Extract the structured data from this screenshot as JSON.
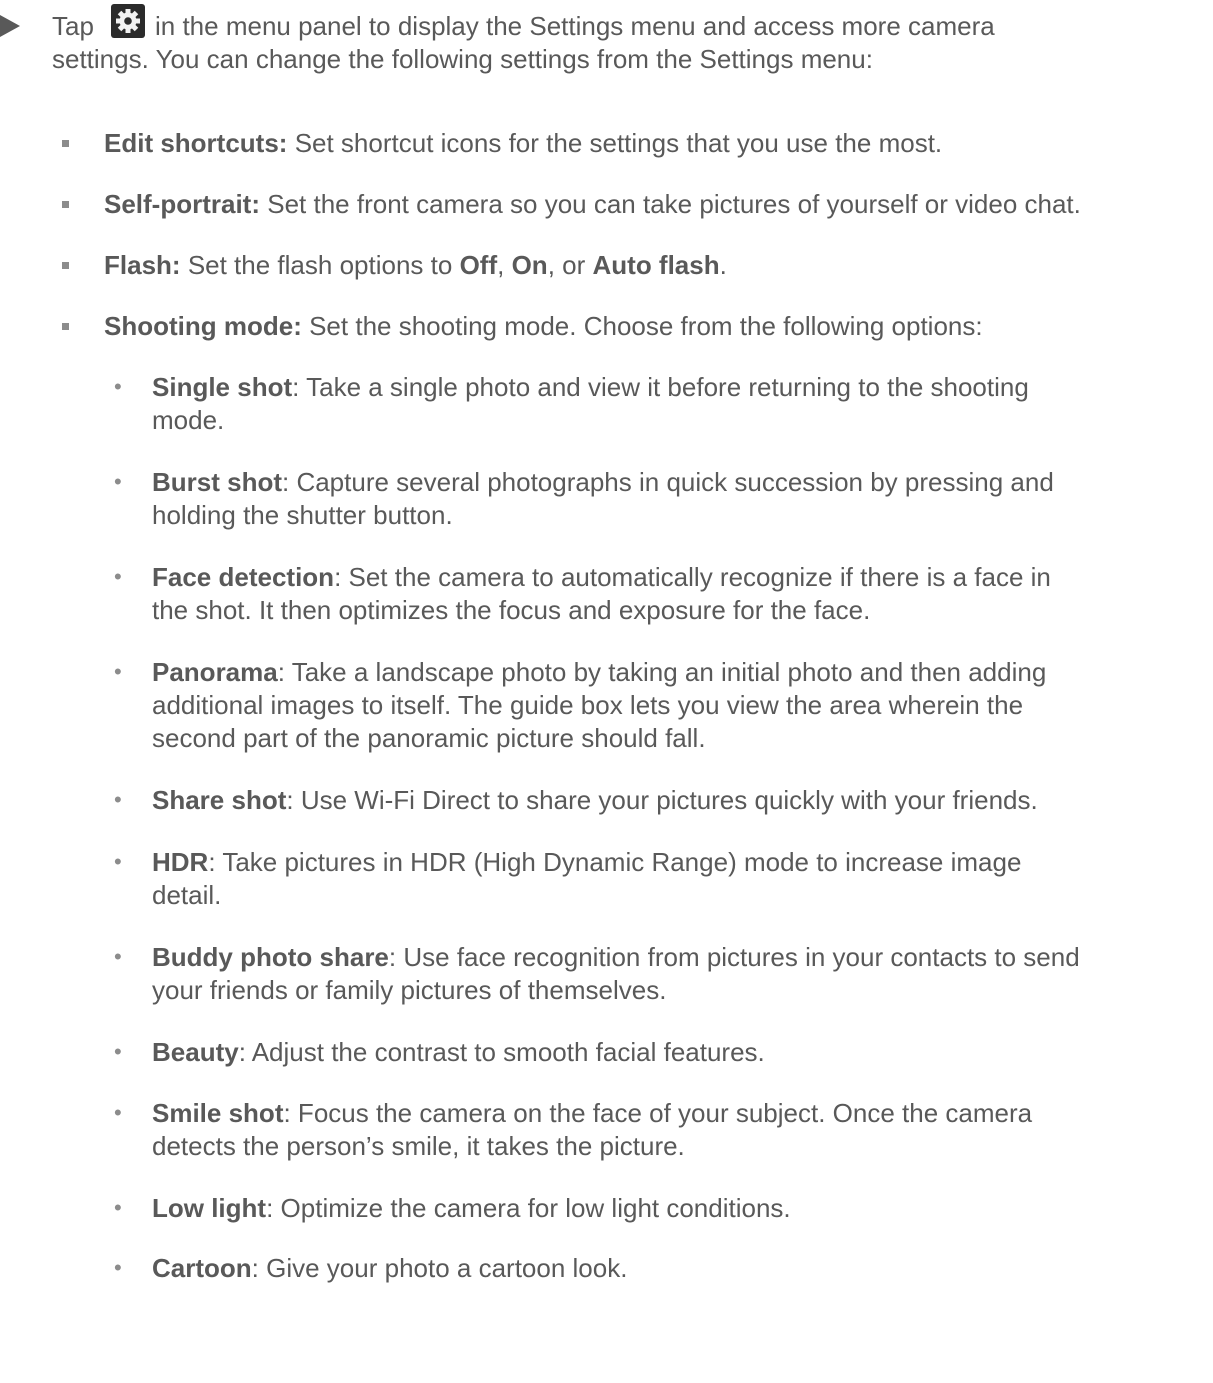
{
  "intro": {
    "before_icon": "Tap",
    "icon": "settings-gear-icon",
    "after_icon": "in the menu panel to display the Settings menu and access more camera",
    "line2": "settings. You can change the following settings from the Settings menu:"
  },
  "settings": [
    {
      "label": "Edit shortcuts:",
      "text": "Set shortcut icons for the settings that you use the most."
    },
    {
      "label": "Self-portrait:",
      "text": "Set the front camera so you can take pictures of yourself or video chat."
    },
    {
      "label": "Flash:",
      "text": "Set the flash options to",
      "opt1": "Off",
      "sep1": ",",
      "opt2": "On",
      "sep2": ", or",
      "opt3": "Auto flash",
      "end": "."
    },
    {
      "label": "Shooting mode:",
      "text": "Set the shooting mode. Choose from the following options:"
    }
  ],
  "modes": [
    {
      "label": "Single shot",
      "lines": [
        ": Take a single photo and view it before returning to the shooting",
        "mode."
      ]
    },
    {
      "label": "Burst shot",
      "lines": [
        ": Capture several photographs in quick succession by pressing and",
        "holding the shutter button."
      ]
    },
    {
      "label": "Face detection",
      "lines": [
        ": Set the camera to automatically recognize if there is a face in",
        "the shot. It then optimizes the focus and exposure for the face."
      ]
    },
    {
      "label": "Panorama",
      "lines": [
        ": Take a landscape photo by taking an initial photo and then adding",
        "additional images to itself. The guide box lets you view the area wherein the",
        "second part of the panoramic picture should fall."
      ]
    },
    {
      "label": "Share shot",
      "lines": [
        ": Use Wi-Fi Direct to share your pictures quickly with your friends."
      ]
    },
    {
      "label": "HDR",
      "lines": [
        ": Take pictures in HDR (High Dynamic Range) mode to increase image",
        "detail."
      ]
    },
    {
      "label": "Buddy photo share",
      "lines": [
        ": Use face recognition from pictures in your contacts to send",
        "your friends or family pictures of themselves."
      ]
    },
    {
      "label": "Beauty",
      "lines": [
        ": Adjust the contrast to smooth facial features."
      ]
    },
    {
      "label": "Smile shot",
      "lines": [
        ": Focus the camera on the face of your subject. Once the camera",
        "detects the person’s smile, it takes the picture."
      ]
    },
    {
      "label": "Low light",
      "lines": [
        ": Optimize the camera for low light conditions."
      ]
    },
    {
      "label": "Cartoon",
      "lines": [
        ": Give your photo a cartoon look."
      ]
    }
  ]
}
